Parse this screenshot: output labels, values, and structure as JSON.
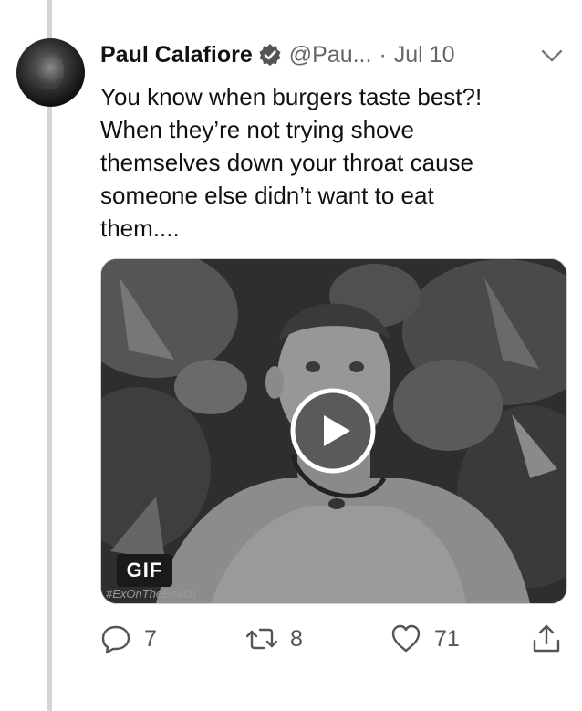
{
  "tweet": {
    "author_name": "Paul Calafiore",
    "handle": "@Pau...",
    "separator": "·",
    "date": "Jul 10",
    "text_lines": [
      "You know when burgers taste best?!",
      "When they’re not trying shove",
      "themselves down your throat cause",
      "someone else didn’t want to eat",
      "them...."
    ],
    "media": {
      "badge": "GIF",
      "watermark": "#ExOnTheBeach"
    },
    "actions": {
      "reply_count": "7",
      "retweet_count": "8",
      "like_count": "71"
    }
  },
  "icons": {
    "verified": "verified-badge-icon",
    "more": "chevron-down-icon",
    "play": "play-icon",
    "reply": "reply-icon",
    "retweet": "retweet-icon",
    "like": "heart-icon",
    "share": "share-icon"
  },
  "colors": {
    "thread_line": "#d4d4d4",
    "secondary_text": "#666666",
    "primary_text": "#111111"
  }
}
